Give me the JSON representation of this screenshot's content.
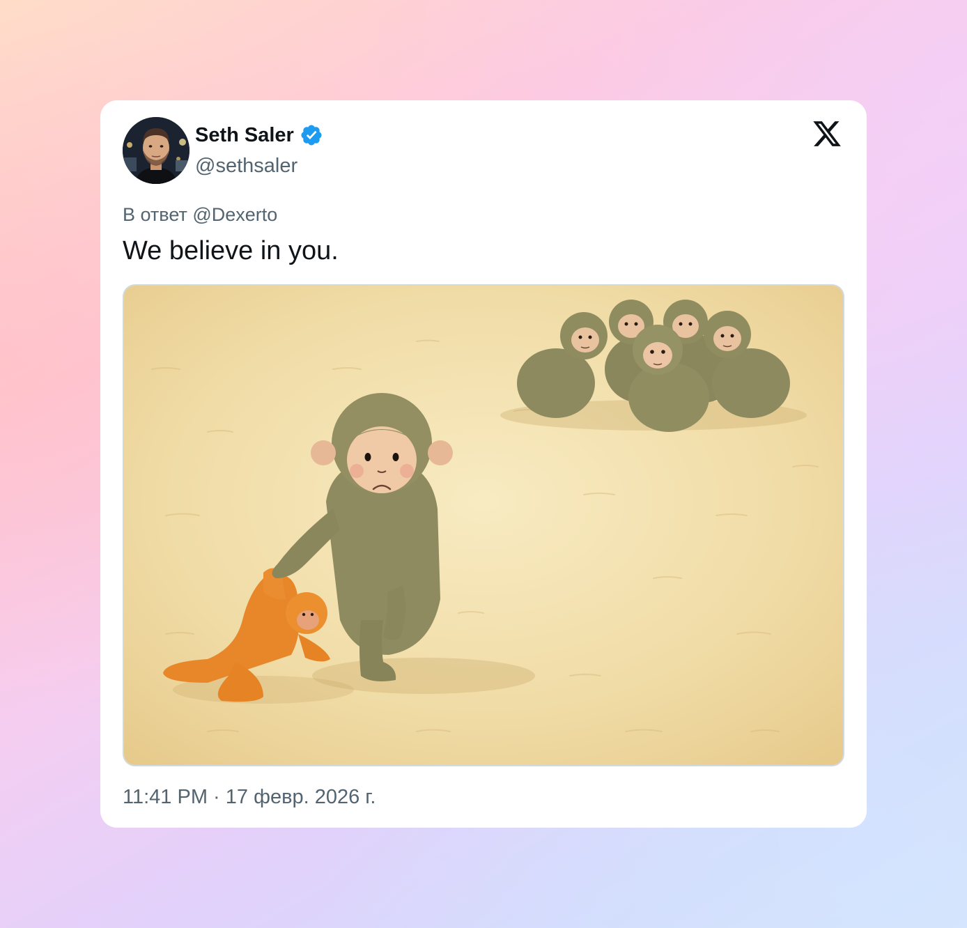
{
  "tweet": {
    "author": {
      "display_name": "Seth Saler",
      "handle": "@sethsaler",
      "verified": true,
      "verified_color": "#1d9bf0",
      "avatar_icon": "profile-photo"
    },
    "platform_icon": "x-logo-icon",
    "reply_prefix": "В ответ",
    "reply_to": "@Dexerto",
    "text": "We believe in you.",
    "media": {
      "type": "illustration",
      "icon": "monkey-illustration"
    },
    "time": "11:41 PM",
    "separator": "·",
    "date": "17 февр. 2026 г."
  },
  "colors": {
    "text_primary": "#0f1419",
    "text_secondary": "#536471",
    "card_background": "#ffffff"
  }
}
